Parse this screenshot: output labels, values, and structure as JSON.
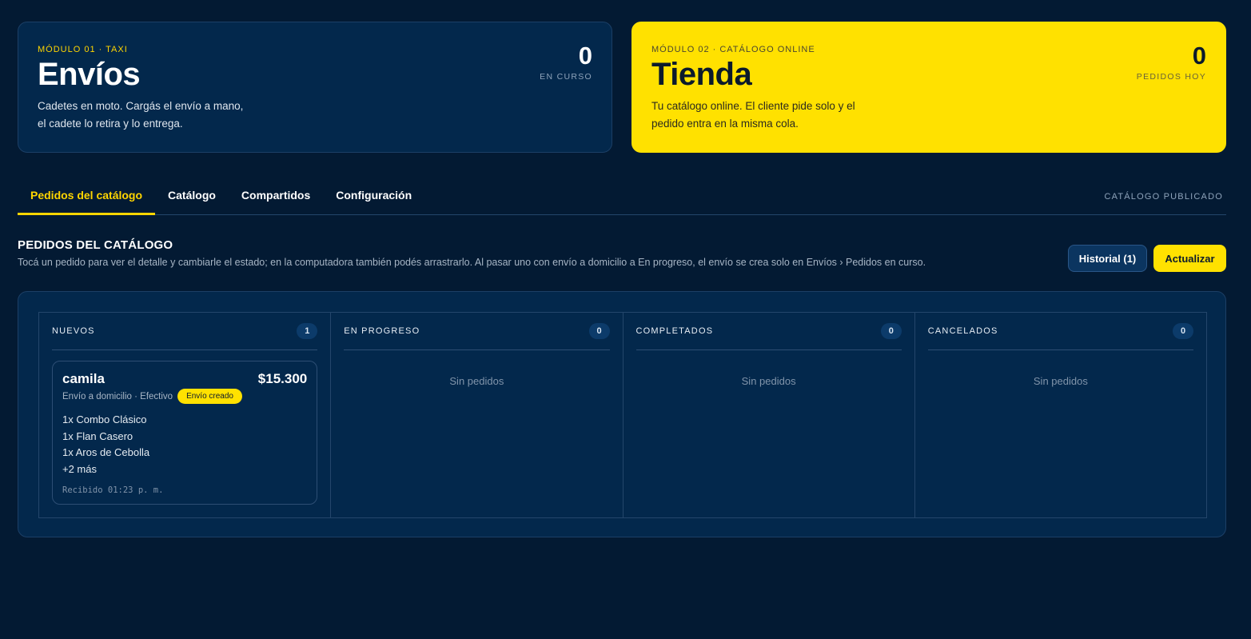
{
  "modules": {
    "taxi": {
      "kicker": "MÓDULO 01 · TAXI",
      "title": "Envíos",
      "description": "Cadetes en moto. Cargás el envío a mano, el cadete lo retira y lo entrega.",
      "counter_value": "0",
      "counter_label": "EN CURSO"
    },
    "tienda": {
      "kicker": "MÓDULO 02 · CATÁLOGO ONLINE",
      "title": "Tienda",
      "description": "Tu catálogo online. El cliente pide solo y el pedido entra en la misma cola.",
      "counter_value": "0",
      "counter_label": "PEDIDOS HOY"
    }
  },
  "tabs": {
    "items": [
      {
        "label": "Pedidos del catálogo",
        "active": true
      },
      {
        "label": "Catálogo",
        "active": false
      },
      {
        "label": "Compartidos",
        "active": false
      },
      {
        "label": "Configuración",
        "active": false
      }
    ],
    "status": "CATÁLOGO PUBLICADO"
  },
  "section": {
    "title": "PEDIDOS DEL CATÁLOGO",
    "description": "Tocá un pedido para ver el detalle y cambiarle el estado; en la computadora también podés arrastrarlo. Al pasar uno con envío a domicilio a En progreso, el envío se crea solo en Envíos › Pedidos en curso.",
    "history_button": "Historial (1)",
    "refresh_button": "Actualizar"
  },
  "board": {
    "columns": [
      {
        "title": "NUEVOS",
        "count": "1"
      },
      {
        "title": "EN PROGRESO",
        "count": "0",
        "empty": "Sin pedidos"
      },
      {
        "title": "COMPLETADOS",
        "count": "0",
        "empty": "Sin pedidos"
      },
      {
        "title": "CANCELADOS",
        "count": "0",
        "empty": "Sin pedidos"
      }
    ],
    "order": {
      "customer": "camila",
      "total": "$15.300",
      "meta": "Envío a domicilio · Efectivo",
      "badge": "Envío creado",
      "items": [
        "1x Combo Clásico",
        "1x Flan Casero",
        "1x Aros de Cebolla",
        "+2 más"
      ],
      "received": "Recibido 01:23 p. m."
    }
  },
  "colors": {
    "background": "#031a33",
    "card": "#03284c",
    "accent": "#ffe100"
  }
}
